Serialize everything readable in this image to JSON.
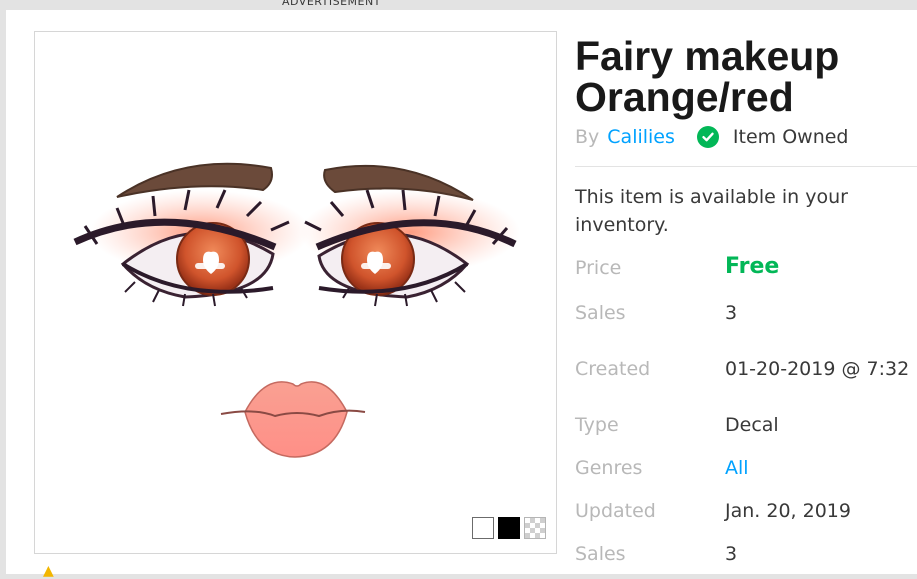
{
  "ad_label": "ADVERTISEMENT",
  "item": {
    "title": "Fairy makeup Orange/red",
    "by_label": "By",
    "creator": "Calilies",
    "owned_label": "Item Owned",
    "availability": "This item is available in your inventory."
  },
  "details": {
    "price_label": "Price",
    "price_value": "Free",
    "sales_label": "Sales",
    "sales_value": "3",
    "created_label": "Created",
    "created_value": "01-20-2019 @ 7:32",
    "type_label": "Type",
    "type_value": "Decal",
    "genres_label": "Genres",
    "genres_value": "All",
    "updated_label": "Updated",
    "updated_value": "Jan. 20, 2019",
    "sales2_label": "Sales",
    "sales2_value": "3"
  },
  "colors": {
    "link": "#00a2ff",
    "free": "#02b757",
    "muted_label": "#b8b8b8",
    "text": "#393939"
  },
  "icons": [
    "check-circle-icon",
    "warning-icon"
  ]
}
